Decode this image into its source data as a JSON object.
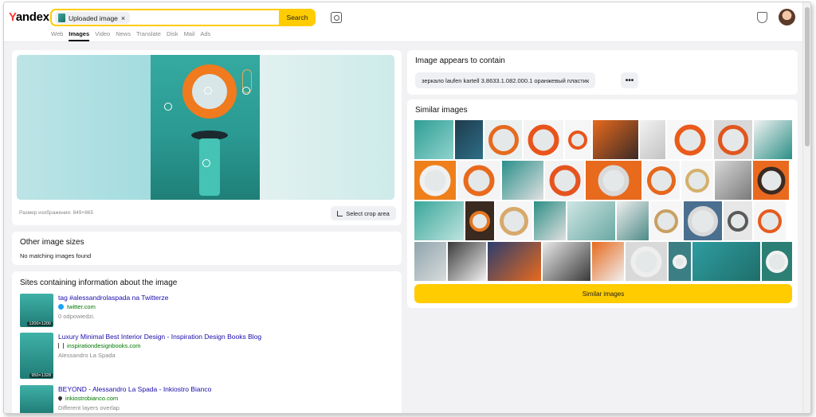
{
  "header": {
    "logo_y": "Y",
    "logo_rest": "andex",
    "search_chip_label": "Uploaded image",
    "chip_close": "×",
    "search_button": "Search",
    "nav": [
      {
        "label": "Web",
        "active": false
      },
      {
        "label": "Images",
        "active": true
      },
      {
        "label": "Video",
        "active": false
      },
      {
        "label": "News",
        "active": false
      },
      {
        "label": "Translate",
        "active": false
      },
      {
        "label": "Disk",
        "active": false
      },
      {
        "label": "Mail",
        "active": false
      },
      {
        "label": "Ads",
        "active": false
      }
    ]
  },
  "image_panel": {
    "size_text": "Размер изображения: 849×865",
    "crop_button": "Select crop area"
  },
  "other_sizes": {
    "title": "Other image sizes",
    "message": "No matching images found"
  },
  "sites": {
    "title": "Sites containing information about the image",
    "items": [
      {
        "title": "tag #alessandrolaspada na Twitterze",
        "host": "twitter.com",
        "desc": "0 odpowiedzi.",
        "badge": "1200×1200",
        "favicon": "twitter-icon",
        "favicon_color": "#1da1f2"
      },
      {
        "title": "Luxury Minimal Best Interior Design - Inspiration Design Books Blog",
        "host": "inspirationdesignbooks.com",
        "desc": "Alessandro La Spada",
        "badge": "950×1328",
        "favicon": "bracket-icon",
        "favicon_color": "#555555"
      },
      {
        "title": "BEYOND - Alessandro La Spada - Inkiostro Bianco",
        "host": "inkiostrobianco.com",
        "desc": "Different layers overlap",
        "badge": "",
        "favicon": "drop-icon",
        "favicon_color": "#333333"
      }
    ]
  },
  "contains": {
    "title": "Image appears to contain",
    "tag": "зеркало laufen kartell 3.8633.1.082.000.1 оранжевый пластик",
    "more": "•••"
  },
  "similar": {
    "title": "Similar images",
    "button": "Similar images"
  },
  "colors": {
    "accent": "#ffcc00",
    "link": "#1a0dab",
    "host": "#007700",
    "muted": "#888888"
  }
}
